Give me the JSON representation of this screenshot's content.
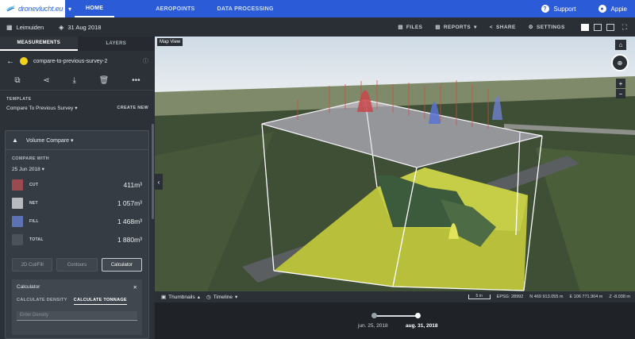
{
  "app": {
    "logo_text": "dronevlucht.eu",
    "nav_tabs": [
      "HOME",
      "AEROPOINTS",
      "DATA PROCESSING"
    ],
    "active_tab": "HOME",
    "support_label": "Support",
    "user_label": "Appie"
  },
  "subbar": {
    "project": "Leimuiden",
    "date": "31 Aug 2018",
    "files": "FILES",
    "reports": "REPORTS",
    "share": "SHARE",
    "settings": "SETTINGS"
  },
  "panel": {
    "tabs": [
      "MEASUREMENTS",
      "LAYERS"
    ],
    "measurement_name": "compare-to-previous-survey-2",
    "template_label": "TEMPLATE",
    "template_value": "Compare To Previous Survey",
    "create_new": "CREATE NEW",
    "card": {
      "title": "Volume Compare",
      "compare_with_label": "COMPARE WITH",
      "compare_date": "25 Jun 2018",
      "rows": [
        {
          "label": "CUT",
          "value": "411m³",
          "color": "#9b4a50"
        },
        {
          "label": "NET",
          "value": "1 057m³",
          "color": "#b8bcc0"
        },
        {
          "label": "FILL",
          "value": "1 468m³",
          "color": "#5b73b2"
        },
        {
          "label": "TOTAL",
          "value": "1 880m³",
          "color": "#4b525a"
        }
      ],
      "buttons": [
        "2D Cut/Fill",
        "Contours",
        "Calculator"
      ],
      "selected_button": "Calculator",
      "calculator": {
        "title": "Calculator",
        "tabs": [
          "CALCULATE DENSITY",
          "CALCULATE TONNAGE"
        ],
        "active_tab": "CALCULATE TONNAGE",
        "input_placeholder": "Enter Density"
      }
    }
  },
  "viewport": {
    "label": "Map View",
    "thumbnails": "Thumbnails",
    "timeline": "Timeline",
    "scale": "5 m",
    "epsg": "EPSG: 28992",
    "north": "N 469 913.055 m",
    "east": "E 106 771.904 m",
    "z": "Z -8.038 m"
  },
  "timeline": {
    "dates": [
      "jun. 25, 2018",
      "aug. 31, 2018"
    ],
    "active_date": "aug. 31, 2018"
  }
}
